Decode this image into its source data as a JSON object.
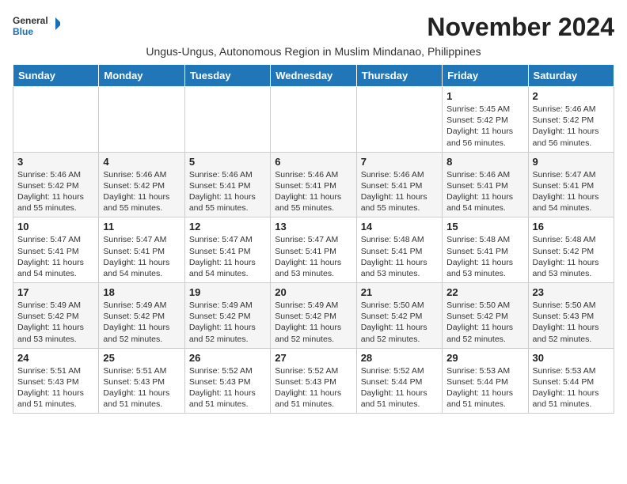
{
  "header": {
    "logo_general": "General",
    "logo_blue": "Blue",
    "month_title": "November 2024",
    "subtitle": "Ungus-Ungus, Autonomous Region in Muslim Mindanao, Philippines"
  },
  "weekdays": [
    "Sunday",
    "Monday",
    "Tuesday",
    "Wednesday",
    "Thursday",
    "Friday",
    "Saturday"
  ],
  "weeks": [
    [
      {
        "day": "",
        "info": ""
      },
      {
        "day": "",
        "info": ""
      },
      {
        "day": "",
        "info": ""
      },
      {
        "day": "",
        "info": ""
      },
      {
        "day": "",
        "info": ""
      },
      {
        "day": "1",
        "info": "Sunrise: 5:45 AM\nSunset: 5:42 PM\nDaylight: 11 hours\nand 56 minutes."
      },
      {
        "day": "2",
        "info": "Sunrise: 5:46 AM\nSunset: 5:42 PM\nDaylight: 11 hours\nand 56 minutes."
      }
    ],
    [
      {
        "day": "3",
        "info": "Sunrise: 5:46 AM\nSunset: 5:42 PM\nDaylight: 11 hours\nand 55 minutes."
      },
      {
        "day": "4",
        "info": "Sunrise: 5:46 AM\nSunset: 5:42 PM\nDaylight: 11 hours\nand 55 minutes."
      },
      {
        "day": "5",
        "info": "Sunrise: 5:46 AM\nSunset: 5:41 PM\nDaylight: 11 hours\nand 55 minutes."
      },
      {
        "day": "6",
        "info": "Sunrise: 5:46 AM\nSunset: 5:41 PM\nDaylight: 11 hours\nand 55 minutes."
      },
      {
        "day": "7",
        "info": "Sunrise: 5:46 AM\nSunset: 5:41 PM\nDaylight: 11 hours\nand 55 minutes."
      },
      {
        "day": "8",
        "info": "Sunrise: 5:46 AM\nSunset: 5:41 PM\nDaylight: 11 hours\nand 54 minutes."
      },
      {
        "day": "9",
        "info": "Sunrise: 5:47 AM\nSunset: 5:41 PM\nDaylight: 11 hours\nand 54 minutes."
      }
    ],
    [
      {
        "day": "10",
        "info": "Sunrise: 5:47 AM\nSunset: 5:41 PM\nDaylight: 11 hours\nand 54 minutes."
      },
      {
        "day": "11",
        "info": "Sunrise: 5:47 AM\nSunset: 5:41 PM\nDaylight: 11 hours\nand 54 minutes."
      },
      {
        "day": "12",
        "info": "Sunrise: 5:47 AM\nSunset: 5:41 PM\nDaylight: 11 hours\nand 54 minutes."
      },
      {
        "day": "13",
        "info": "Sunrise: 5:47 AM\nSunset: 5:41 PM\nDaylight: 11 hours\nand 53 minutes."
      },
      {
        "day": "14",
        "info": "Sunrise: 5:48 AM\nSunset: 5:41 PM\nDaylight: 11 hours\nand 53 minutes."
      },
      {
        "day": "15",
        "info": "Sunrise: 5:48 AM\nSunset: 5:41 PM\nDaylight: 11 hours\nand 53 minutes."
      },
      {
        "day": "16",
        "info": "Sunrise: 5:48 AM\nSunset: 5:42 PM\nDaylight: 11 hours\nand 53 minutes."
      }
    ],
    [
      {
        "day": "17",
        "info": "Sunrise: 5:49 AM\nSunset: 5:42 PM\nDaylight: 11 hours\nand 53 minutes."
      },
      {
        "day": "18",
        "info": "Sunrise: 5:49 AM\nSunset: 5:42 PM\nDaylight: 11 hours\nand 52 minutes."
      },
      {
        "day": "19",
        "info": "Sunrise: 5:49 AM\nSunset: 5:42 PM\nDaylight: 11 hours\nand 52 minutes."
      },
      {
        "day": "20",
        "info": "Sunrise: 5:49 AM\nSunset: 5:42 PM\nDaylight: 11 hours\nand 52 minutes."
      },
      {
        "day": "21",
        "info": "Sunrise: 5:50 AM\nSunset: 5:42 PM\nDaylight: 11 hours\nand 52 minutes."
      },
      {
        "day": "22",
        "info": "Sunrise: 5:50 AM\nSunset: 5:42 PM\nDaylight: 11 hours\nand 52 minutes."
      },
      {
        "day": "23",
        "info": "Sunrise: 5:50 AM\nSunset: 5:43 PM\nDaylight: 11 hours\nand 52 minutes."
      }
    ],
    [
      {
        "day": "24",
        "info": "Sunrise: 5:51 AM\nSunset: 5:43 PM\nDaylight: 11 hours\nand 51 minutes."
      },
      {
        "day": "25",
        "info": "Sunrise: 5:51 AM\nSunset: 5:43 PM\nDaylight: 11 hours\nand 51 minutes."
      },
      {
        "day": "26",
        "info": "Sunrise: 5:52 AM\nSunset: 5:43 PM\nDaylight: 11 hours\nand 51 minutes."
      },
      {
        "day": "27",
        "info": "Sunrise: 5:52 AM\nSunset: 5:43 PM\nDaylight: 11 hours\nand 51 minutes."
      },
      {
        "day": "28",
        "info": "Sunrise: 5:52 AM\nSunset: 5:44 PM\nDaylight: 11 hours\nand 51 minutes."
      },
      {
        "day": "29",
        "info": "Sunrise: 5:53 AM\nSunset: 5:44 PM\nDaylight: 11 hours\nand 51 minutes."
      },
      {
        "day": "30",
        "info": "Sunrise: 5:53 AM\nSunset: 5:44 PM\nDaylight: 11 hours\nand 51 minutes."
      }
    ]
  ]
}
